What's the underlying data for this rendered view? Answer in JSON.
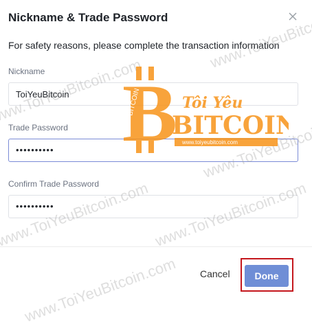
{
  "dialog": {
    "title": "Nickname & Trade Password",
    "subtitle": "For safety reasons, please complete the transaction information"
  },
  "fields": {
    "nickname": {
      "label": "Nickname",
      "value": "ToiYeuBitcoin"
    },
    "trade_password": {
      "label": "Trade Password",
      "value": "••••••••••"
    },
    "confirm_password": {
      "label": "Confirm Trade Password",
      "value": "••••••••••"
    }
  },
  "actions": {
    "cancel_label": "Cancel",
    "done_label": "Done"
  },
  "watermark": {
    "repeat_text": "www.ToiYeuBitcoin.com",
    "logo_text_top": "Tôi Yêu",
    "logo_text_main": "BITCOIN",
    "logo_url": "www.toiyeubitcoin.com",
    "logo_coin": "BITCOIN"
  },
  "colors": {
    "primary_button": "#6f8ed6",
    "highlight_box": "#c4161c",
    "watermark_orange": "#f7931a"
  },
  "icons": {
    "close": "close-icon"
  }
}
